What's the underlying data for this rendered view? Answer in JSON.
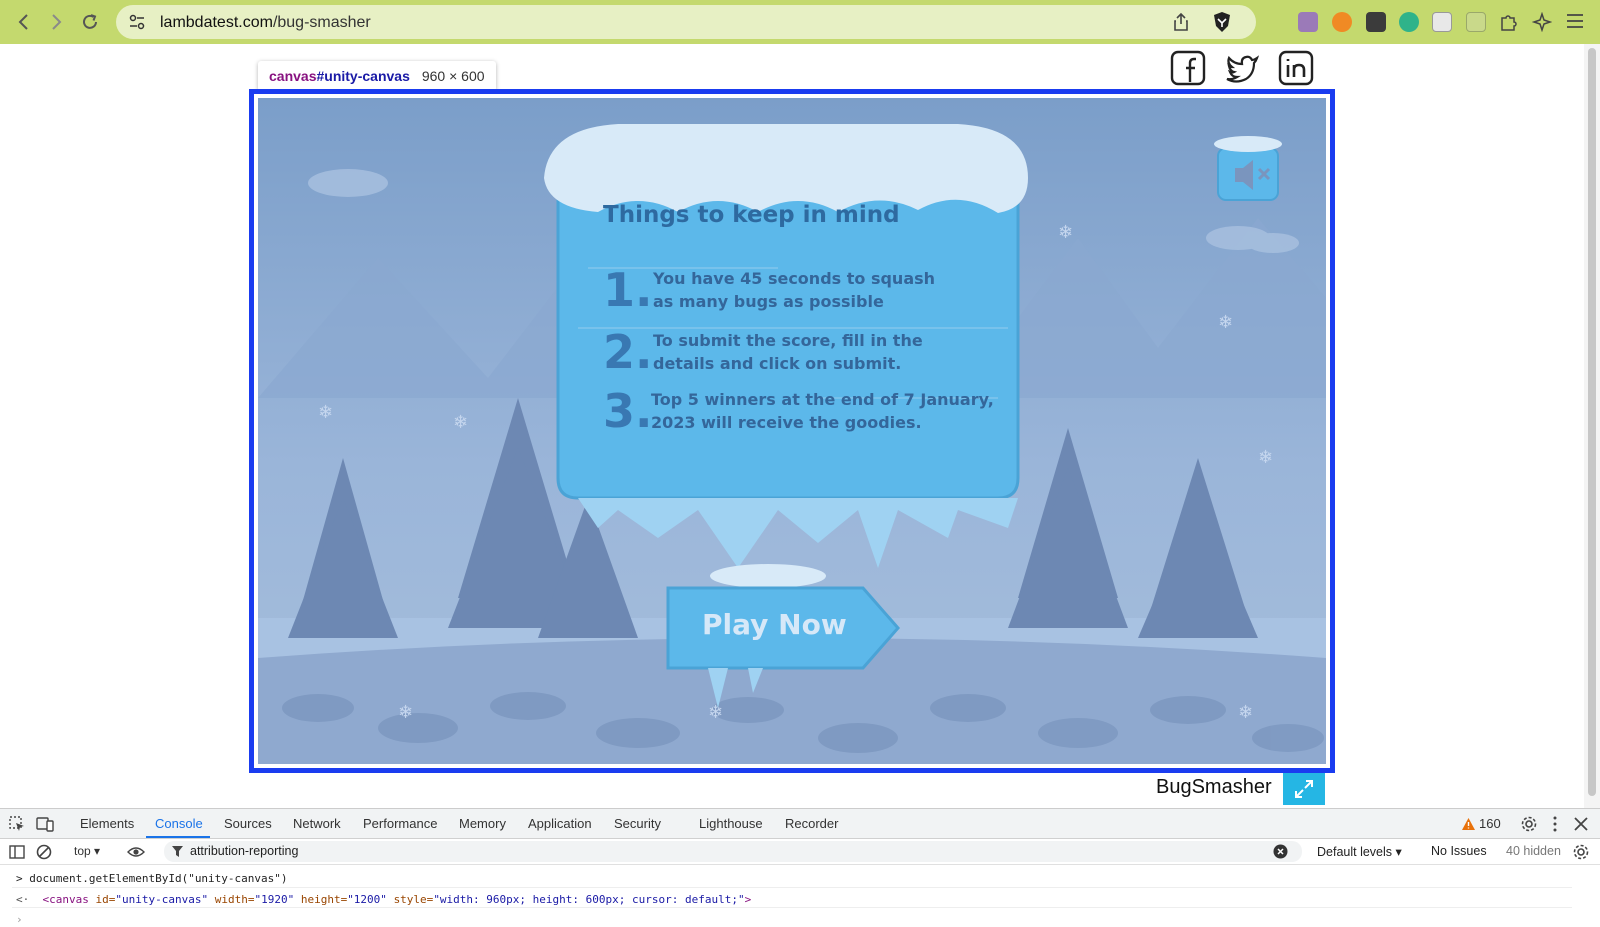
{
  "browser": {
    "url_host": "lambdatest.com",
    "url_path": "/bug-smasher"
  },
  "tooltip": {
    "tag": "canvas",
    "id": "#unity-canvas",
    "dims": "960 × 600"
  },
  "game": {
    "board_title": "Things to keep in mind",
    "rules": [
      {
        "num": "1.",
        "text_line1": "You have 45 seconds to squash",
        "text_line2": "as many bugs as possible"
      },
      {
        "num": "2.",
        "text_line1": "To submit the score, fill in the",
        "text_line2": "details and click on submit."
      },
      {
        "num": "3.",
        "text_line1": "Top 5 winners at the end of 7 January,",
        "text_line2": "2023 will receive the goodies."
      }
    ],
    "play_label": "Play Now"
  },
  "footer": {
    "brand": "BugSmasher"
  },
  "devtools": {
    "tabs": [
      "Elements",
      "Console",
      "Sources",
      "Network",
      "Performance",
      "Memory",
      "Application",
      "Security",
      "Lighthouse",
      "Recorder"
    ],
    "active_tab": "Console",
    "warning_count": "160",
    "context": "top",
    "filter": "attribution-reporting",
    "levels": "Default levels",
    "issues": "No Issues",
    "hidden": "40 hidden",
    "console_input": "document.getElementById(\"unity-canvas\")",
    "console_output": {
      "tag_open": "<canvas",
      "id_attr": "id=",
      "id_val": "\"unity-canvas\"",
      "width_attr": "width=",
      "width_val": "\"1920\"",
      "height_attr": "height=",
      "height_val": "\"1200\"",
      "style_attr": "style=",
      "style_val": "\"width: 960px; height: 600px; cursor: default;\"",
      "tag_close": ">"
    }
  },
  "colors": {
    "chrome_bg": "#c4d96e",
    "highlight_border": "#1a3cf0",
    "board_ice": "#5cb8ea",
    "fullscreen_btn": "#25b6e4",
    "devtools_accent": "#1a73e8"
  }
}
